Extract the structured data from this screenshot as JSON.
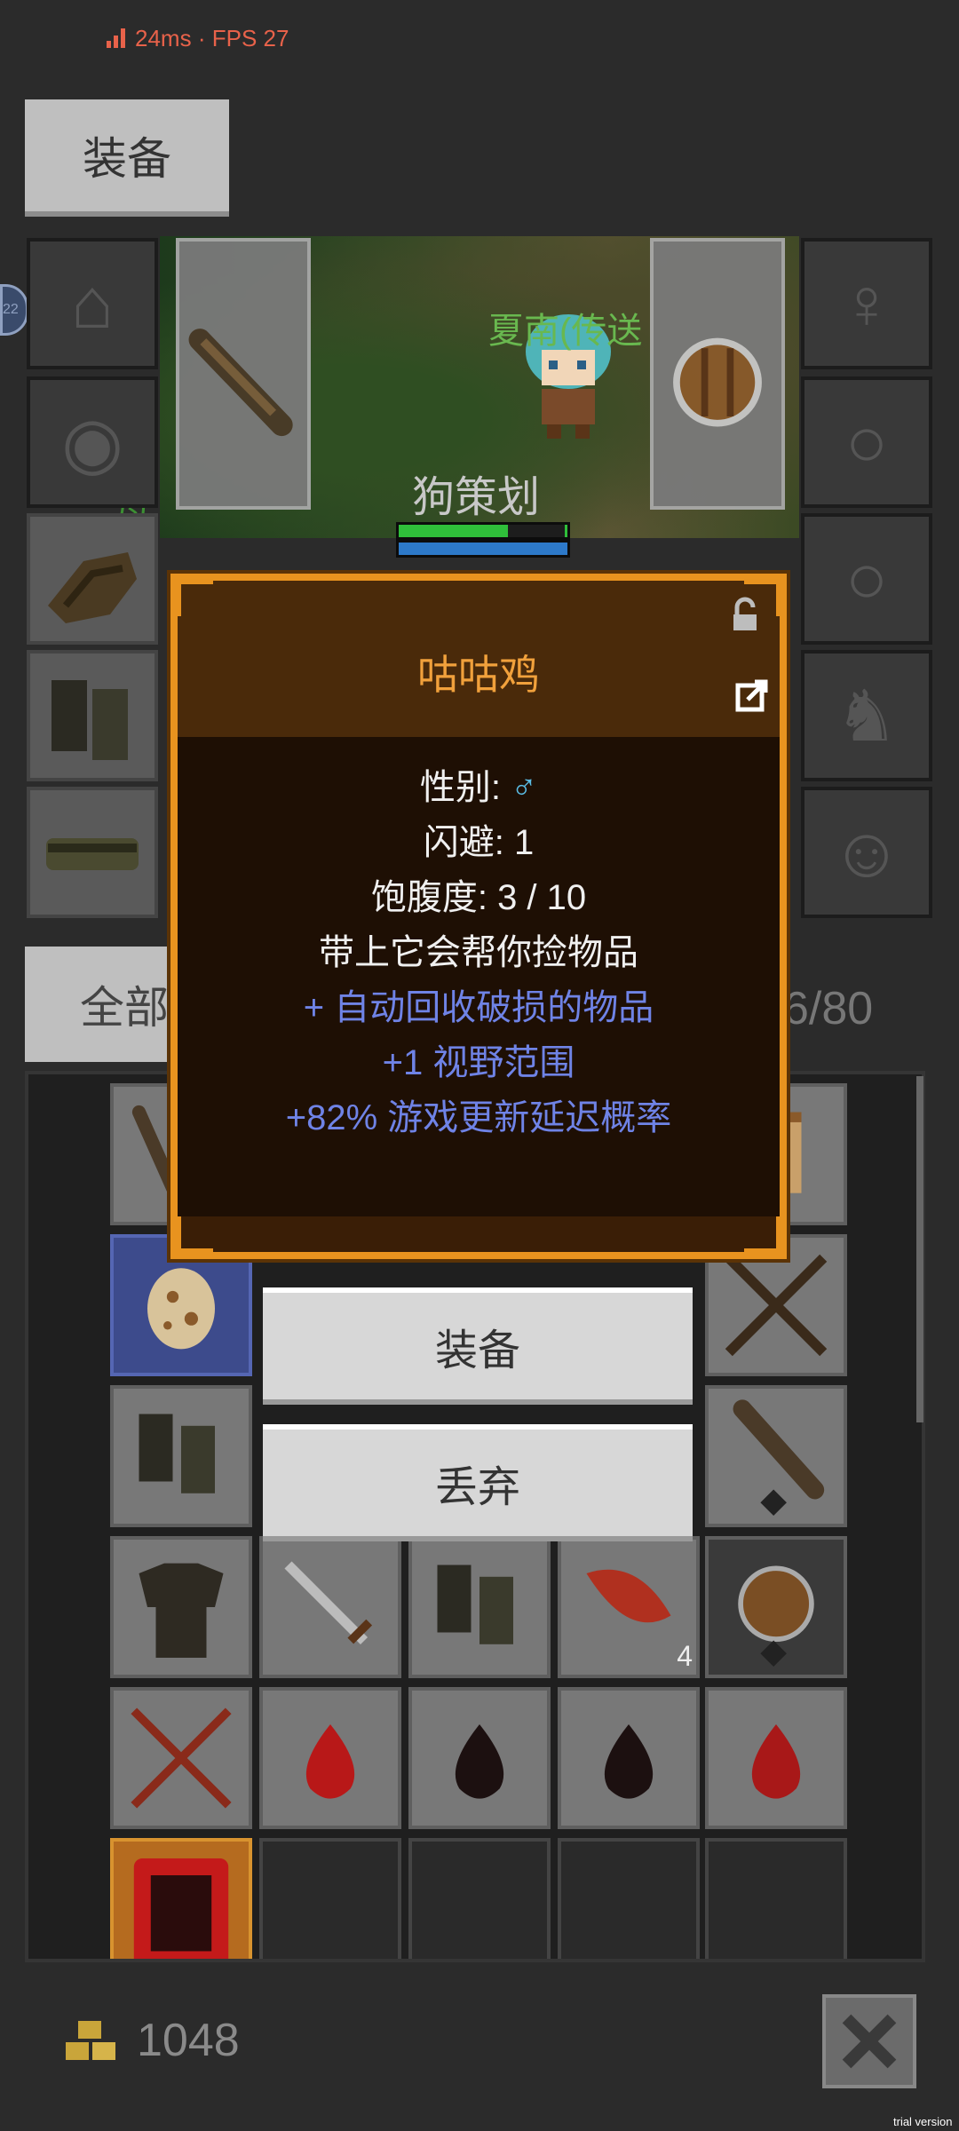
{
  "status": {
    "latency": "24ms",
    "separator": "·",
    "fps": "FPS 27"
  },
  "equip_tab": {
    "label": "装备"
  },
  "scene": {
    "npc_name": "夏南(传送",
    "player_name": "狗策划",
    "left_marker": "22",
    "left_text": "母"
  },
  "inventory": {
    "tab_all": "全部",
    "count": "6/80",
    "leaf_stack": "4"
  },
  "item_dialog": {
    "title": "咕咕鸡",
    "gender_label": "性别:",
    "gender_symbol": "♂",
    "lines": [
      "闪避: 1",
      "饱腹度: 3 / 10",
      "带上它会帮你捡物品"
    ],
    "bonuses": [
      "+ 自动回收破损的物品",
      "+1 视野范围",
      "+82% 游戏更新延迟概率"
    ]
  },
  "actions": {
    "equip": "装备",
    "drop": "丢弃"
  },
  "footer": {
    "gold": "1048",
    "watermark": "trial version"
  },
  "icons": [
    "signal-icon",
    "helmet-icon",
    "amulet-icon",
    "glove-icon",
    "boot-icon",
    "belt-icon",
    "ring-icon",
    "trinket-icon",
    "club-icon",
    "shield-icon",
    "export-icon",
    "lock-icon",
    "gold-icon",
    "close-icon",
    "egg-icon",
    "sword-icon",
    "potion-icon",
    "armor-icon",
    "backpack-icon"
  ],
  "colors": {
    "accent": "#e8931f",
    "bonus": "#6f83e6",
    "male": "#5bbde6",
    "title": "#f1a13c"
  }
}
